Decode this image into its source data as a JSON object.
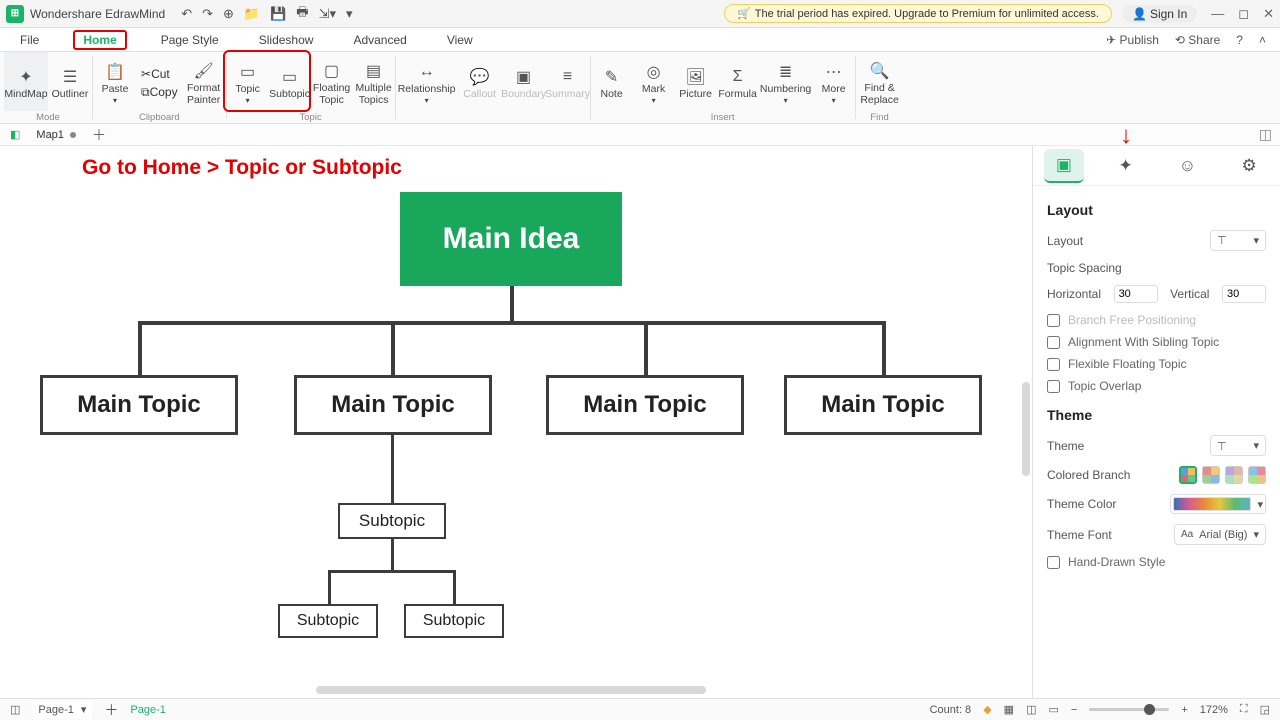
{
  "app": {
    "title": "Wondershare EdrawMind",
    "trial": "The trial period has expired. Upgrade to Premium for unlimited access.",
    "signin": "Sign In"
  },
  "menu": {
    "file": "File",
    "home": "Home",
    "pagestyle": "Page Style",
    "slideshow": "Slideshow",
    "advanced": "Advanced",
    "view": "View",
    "publish": "Publish",
    "share": "Share"
  },
  "ribbon": {
    "mindmap": "MindMap",
    "outliner": "Outliner",
    "modeLabel": "Mode",
    "paste": "Paste",
    "cut": "Cut",
    "copy": "Copy",
    "formatpainter": "Format\nPainter",
    "clipboardLabel": "Clipboard",
    "topic": "Topic",
    "subtopic": "Subtopic",
    "floating": "Floating\nTopic",
    "multiple": "Multiple\nTopics",
    "topicLabel": "Topic",
    "relationship": "Relationship",
    "callout": "Callout",
    "boundary": "Boundary",
    "summary": "Summary",
    "note": "Note",
    "mark": "Mark",
    "picture": "Picture",
    "formula": "Formula",
    "numbering": "Numbering",
    "more": "More",
    "insertLabel": "Insert",
    "findreplace": "Find &\nReplace",
    "findLabel": "Find"
  },
  "tabs": {
    "map1": "Map1"
  },
  "instruction": "Go to Home > Topic or Subtopic",
  "mindmap": {
    "main": "Main Idea",
    "t1": "Main Topic",
    "t2": "Main Topic",
    "t3": "Main Topic",
    "t4": "Main Topic",
    "s1": "Subtopic",
    "s2": "Subtopic",
    "s3": "Subtopic"
  },
  "panel": {
    "layoutTitle": "Layout",
    "layoutLabel": "Layout",
    "topicSpacing": "Topic Spacing",
    "horizontal": "Horizontal",
    "hval": "30",
    "vertical": "Vertical",
    "vval": "30",
    "branchFree": "Branch Free Positioning",
    "alignSibling": "Alignment With Sibling Topic",
    "flexFloat": "Flexible Floating Topic",
    "topicOverlap": "Topic Overlap",
    "themeTitle": "Theme",
    "themeLabel": "Theme",
    "coloredBranch": "Colored Branch",
    "themeColor": "Theme Color",
    "themeFont": "Theme Font",
    "fontValue": "Arial (Big)",
    "handDrawn": "Hand-Drawn Style"
  },
  "status": {
    "page": "Page-1",
    "pageTab": "Page-1",
    "count": "Count: 8",
    "zoom": "172%"
  }
}
